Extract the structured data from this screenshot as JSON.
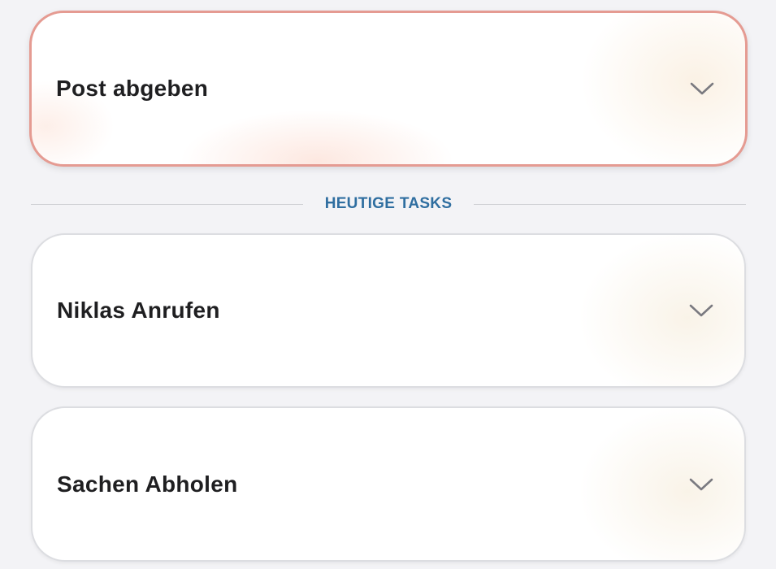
{
  "overdue_task": {
    "title": "Post abgeben"
  },
  "section": {
    "label": "HEUTIGE TASKS"
  },
  "tasks": [
    {
      "title": "Niklas Anrufen"
    },
    {
      "title": "Sachen Abholen"
    }
  ],
  "colors": {
    "overdue_border": "#e59b92",
    "section_label": "#2f6ea0",
    "background": "#f3f3f6",
    "chevron": "#7a7a80"
  },
  "icons": {
    "expand": "chevron-down-icon"
  }
}
